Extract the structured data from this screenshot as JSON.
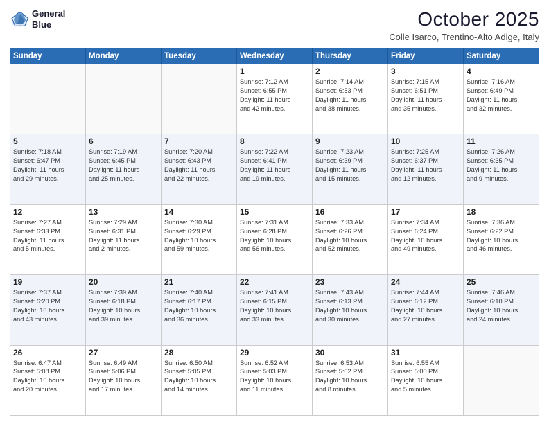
{
  "header": {
    "logo_line1": "General",
    "logo_line2": "Blue",
    "month": "October 2025",
    "location": "Colle Isarco, Trentino-Alto Adige, Italy"
  },
  "days": [
    "Sunday",
    "Monday",
    "Tuesday",
    "Wednesday",
    "Thursday",
    "Friday",
    "Saturday"
  ],
  "weeks": [
    [
      {
        "num": "",
        "text": ""
      },
      {
        "num": "",
        "text": ""
      },
      {
        "num": "",
        "text": ""
      },
      {
        "num": "1",
        "text": "Sunrise: 7:12 AM\nSunset: 6:55 PM\nDaylight: 11 hours\nand 42 minutes."
      },
      {
        "num": "2",
        "text": "Sunrise: 7:14 AM\nSunset: 6:53 PM\nDaylight: 11 hours\nand 38 minutes."
      },
      {
        "num": "3",
        "text": "Sunrise: 7:15 AM\nSunset: 6:51 PM\nDaylight: 11 hours\nand 35 minutes."
      },
      {
        "num": "4",
        "text": "Sunrise: 7:16 AM\nSunset: 6:49 PM\nDaylight: 11 hours\nand 32 minutes."
      }
    ],
    [
      {
        "num": "5",
        "text": "Sunrise: 7:18 AM\nSunset: 6:47 PM\nDaylight: 11 hours\nand 29 minutes."
      },
      {
        "num": "6",
        "text": "Sunrise: 7:19 AM\nSunset: 6:45 PM\nDaylight: 11 hours\nand 25 minutes."
      },
      {
        "num": "7",
        "text": "Sunrise: 7:20 AM\nSunset: 6:43 PM\nDaylight: 11 hours\nand 22 minutes."
      },
      {
        "num": "8",
        "text": "Sunrise: 7:22 AM\nSunset: 6:41 PM\nDaylight: 11 hours\nand 19 minutes."
      },
      {
        "num": "9",
        "text": "Sunrise: 7:23 AM\nSunset: 6:39 PM\nDaylight: 11 hours\nand 15 minutes."
      },
      {
        "num": "10",
        "text": "Sunrise: 7:25 AM\nSunset: 6:37 PM\nDaylight: 11 hours\nand 12 minutes."
      },
      {
        "num": "11",
        "text": "Sunrise: 7:26 AM\nSunset: 6:35 PM\nDaylight: 11 hours\nand 9 minutes."
      }
    ],
    [
      {
        "num": "12",
        "text": "Sunrise: 7:27 AM\nSunset: 6:33 PM\nDaylight: 11 hours\nand 5 minutes."
      },
      {
        "num": "13",
        "text": "Sunrise: 7:29 AM\nSunset: 6:31 PM\nDaylight: 11 hours\nand 2 minutes."
      },
      {
        "num": "14",
        "text": "Sunrise: 7:30 AM\nSunset: 6:29 PM\nDaylight: 10 hours\nand 59 minutes."
      },
      {
        "num": "15",
        "text": "Sunrise: 7:31 AM\nSunset: 6:28 PM\nDaylight: 10 hours\nand 56 minutes."
      },
      {
        "num": "16",
        "text": "Sunrise: 7:33 AM\nSunset: 6:26 PM\nDaylight: 10 hours\nand 52 minutes."
      },
      {
        "num": "17",
        "text": "Sunrise: 7:34 AM\nSunset: 6:24 PM\nDaylight: 10 hours\nand 49 minutes."
      },
      {
        "num": "18",
        "text": "Sunrise: 7:36 AM\nSunset: 6:22 PM\nDaylight: 10 hours\nand 46 minutes."
      }
    ],
    [
      {
        "num": "19",
        "text": "Sunrise: 7:37 AM\nSunset: 6:20 PM\nDaylight: 10 hours\nand 43 minutes."
      },
      {
        "num": "20",
        "text": "Sunrise: 7:39 AM\nSunset: 6:18 PM\nDaylight: 10 hours\nand 39 minutes."
      },
      {
        "num": "21",
        "text": "Sunrise: 7:40 AM\nSunset: 6:17 PM\nDaylight: 10 hours\nand 36 minutes."
      },
      {
        "num": "22",
        "text": "Sunrise: 7:41 AM\nSunset: 6:15 PM\nDaylight: 10 hours\nand 33 minutes."
      },
      {
        "num": "23",
        "text": "Sunrise: 7:43 AM\nSunset: 6:13 PM\nDaylight: 10 hours\nand 30 minutes."
      },
      {
        "num": "24",
        "text": "Sunrise: 7:44 AM\nSunset: 6:12 PM\nDaylight: 10 hours\nand 27 minutes."
      },
      {
        "num": "25",
        "text": "Sunrise: 7:46 AM\nSunset: 6:10 PM\nDaylight: 10 hours\nand 24 minutes."
      }
    ],
    [
      {
        "num": "26",
        "text": "Sunrise: 6:47 AM\nSunset: 5:08 PM\nDaylight: 10 hours\nand 20 minutes."
      },
      {
        "num": "27",
        "text": "Sunrise: 6:49 AM\nSunset: 5:06 PM\nDaylight: 10 hours\nand 17 minutes."
      },
      {
        "num": "28",
        "text": "Sunrise: 6:50 AM\nSunset: 5:05 PM\nDaylight: 10 hours\nand 14 minutes."
      },
      {
        "num": "29",
        "text": "Sunrise: 6:52 AM\nSunset: 5:03 PM\nDaylight: 10 hours\nand 11 minutes."
      },
      {
        "num": "30",
        "text": "Sunrise: 6:53 AM\nSunset: 5:02 PM\nDaylight: 10 hours\nand 8 minutes."
      },
      {
        "num": "31",
        "text": "Sunrise: 6:55 AM\nSunset: 5:00 PM\nDaylight: 10 hours\nand 5 minutes."
      },
      {
        "num": "",
        "text": ""
      }
    ]
  ]
}
